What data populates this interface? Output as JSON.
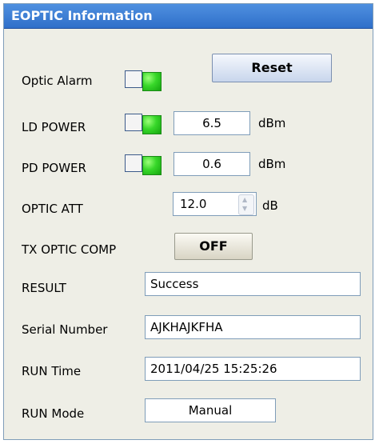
{
  "panel": {
    "title": "EOPTIC Information"
  },
  "optic_alarm": {
    "label": "Optic Alarm"
  },
  "reset_button": {
    "label": "Reset"
  },
  "ld_power": {
    "label": "LD POWER",
    "value": "6.5",
    "unit": "dBm"
  },
  "pd_power": {
    "label": "PD POWER",
    "value": "0.6",
    "unit": "dBm"
  },
  "optic_att": {
    "label": "OPTIC ATT",
    "value": "12.0",
    "unit": "dB"
  },
  "tx_optic_comp": {
    "label": "TX OPTIC COMP",
    "button": "OFF"
  },
  "result": {
    "label": "RESULT",
    "value": "Success"
  },
  "serial_number": {
    "label": "Serial Number",
    "value": "AJKHAJKFHA"
  },
  "run_time": {
    "label": "RUN Time",
    "value": "2011/04/25 15:25:26"
  },
  "run_mode": {
    "label": "RUN Mode",
    "value": "Manual"
  },
  "colors": {
    "title_bg": "#3f80d8",
    "panel_bg": "#eeeee6",
    "led_on": "#2fd41f",
    "border": "#7f9db9"
  }
}
